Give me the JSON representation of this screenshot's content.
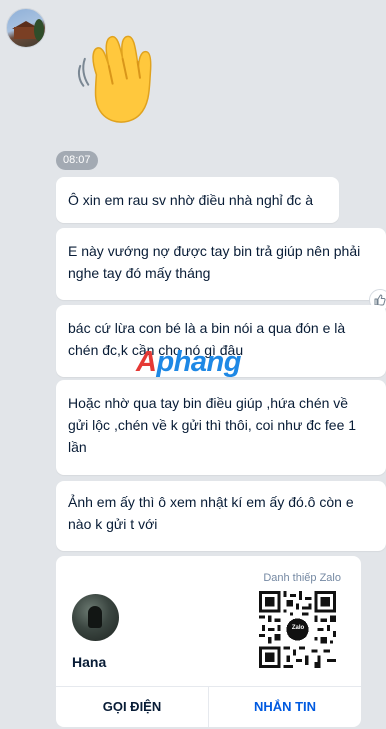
{
  "sender": {
    "avatar_icon": "house-photo-avatar"
  },
  "sticker": {
    "icon": "waving-hand-emoji"
  },
  "time_badge": "08:07",
  "messages": [
    {
      "line1": "Ô xin em rau sv nhờ điều nhà nghỉ đc à"
    },
    {
      "line1": "E này vướng nợ được tay bin  trả giúp nên phải",
      "line2": "nghe tay đó mấy tháng"
    },
    {
      "line1": "bác cứ lừa con bé là a bin nói a qua đón e là",
      "line2": "chén đc,k cần cho nó gì đâu"
    },
    {
      "line1": "Hoặc nhờ qua tay bin điều giúp ,hứa chén về",
      "line2": "gửi lộc ,chén về k gửi thì thôi, coi như đc fee 1",
      "line3": "lần"
    },
    {
      "line1": "Ảnh em ấy thì ô xem nhật kí em ấy đó.ô còn e",
      "line2": "nào k gửi t với"
    }
  ],
  "watermark": {
    "part1": "A",
    "part2": "phang"
  },
  "contact_card": {
    "type_label": "Danh thiếp Zalo",
    "name": "Hana",
    "qr_center_label": "Zalo",
    "call_label": "GỌI ĐIỆN",
    "message_label": "NHẮN TIN"
  },
  "colors": {
    "accent": "#005ae0",
    "background": "#e2e5e9",
    "time_badge_bg": "#a3aab3"
  }
}
